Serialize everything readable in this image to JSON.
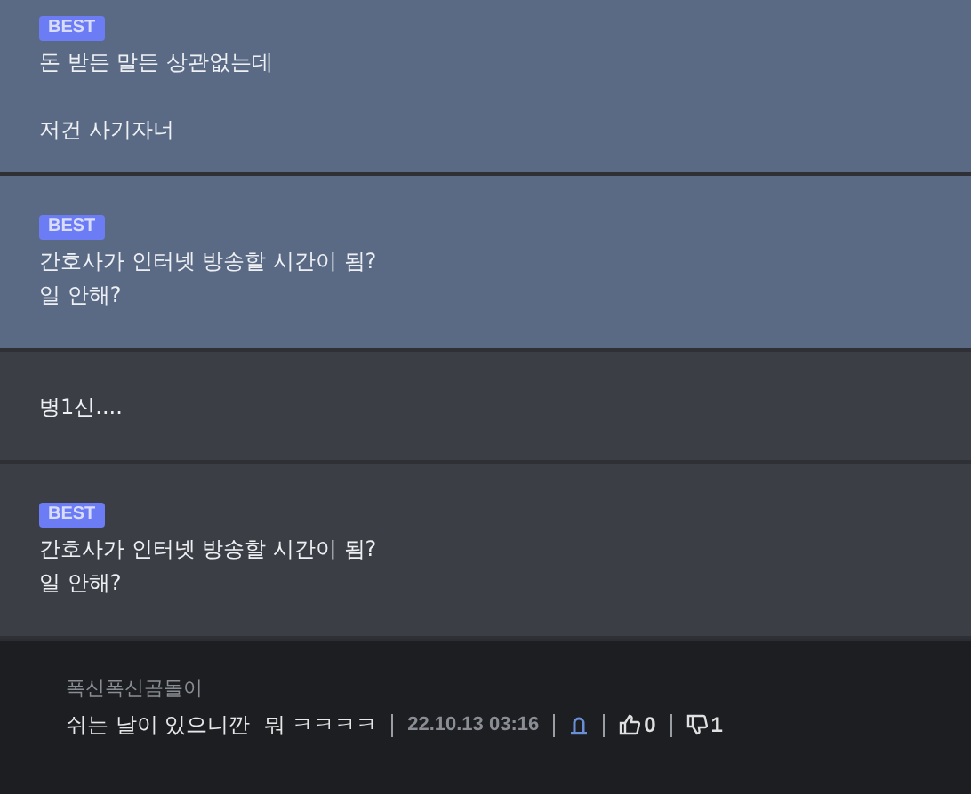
{
  "comments": [
    {
      "best": true,
      "highlighted": true,
      "badge": "BEST",
      "text": "돈 받든 말든 상관없는데\n\n저건 사기자너"
    },
    {
      "best": true,
      "highlighted": true,
      "badge": "BEST",
      "text": "간호사가 인터넷 방송할 시간이 됨?\n일 안해?"
    },
    {
      "best": false,
      "highlighted": false,
      "text": "병1신...."
    },
    {
      "best": true,
      "highlighted": false,
      "badge": "BEST",
      "text": "간호사가 인터넷 방송할 시간이 됨?\n일 안해?"
    }
  ],
  "reply": {
    "author": "폭신폭신곰돌이",
    "text": "쉬는 날이 있으니깐  뭐 ㅋㅋㅋㅋ",
    "date": "22.10.13 03:16",
    "likes": "0",
    "dislikes": "1"
  }
}
